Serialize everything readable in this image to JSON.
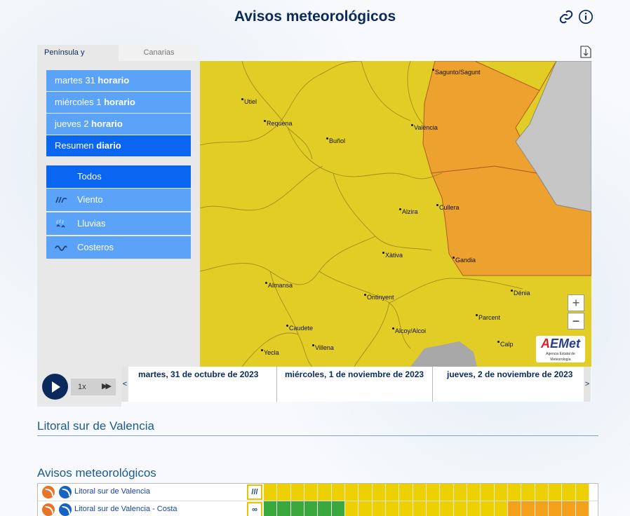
{
  "header": {
    "title": "Avisos meteorológicos"
  },
  "icons": {
    "link": "link-icon",
    "info": "info-icon",
    "download": "download-icon"
  },
  "tabs": [
    {
      "label": "Península y Baleares",
      "active": true
    },
    {
      "label": "Canarias",
      "active": false
    }
  ],
  "days": [
    {
      "prefix": "martes 31 ",
      "bold": "horario",
      "selected": false
    },
    {
      "prefix": "miércoles 1 ",
      "bold": "horario",
      "selected": false
    },
    {
      "prefix": "jueves 2 ",
      "bold": "horario",
      "selected": false
    },
    {
      "prefix": "Resumen ",
      "bold": "diario",
      "selected": true
    }
  ],
  "warning_types": [
    {
      "label": "Todos",
      "icon": "",
      "selected": true
    },
    {
      "label": "Viento",
      "icon": "wind-icon",
      "selected": false
    },
    {
      "label": "Lluvias",
      "icon": "rain-icon",
      "selected": false
    },
    {
      "label": "Costeros",
      "icon": "coastal-icon",
      "selected": false
    }
  ],
  "map": {
    "cities": [
      {
        "name": "Sagunto/Sagunt",
        "id": "sagunto"
      },
      {
        "name": "Utiel",
        "id": "utiel"
      },
      {
        "name": "Requena",
        "id": "requena"
      },
      {
        "name": "València",
        "id": "valencia"
      },
      {
        "name": "Buñol",
        "id": "bunol"
      },
      {
        "name": "Alzira",
        "id": "alzira"
      },
      {
        "name": "Cullera",
        "id": "cullera"
      },
      {
        "name": "Xàtiva",
        "id": "xativa"
      },
      {
        "name": "Gandia",
        "id": "gandia"
      },
      {
        "name": "Almansa",
        "id": "almansa"
      },
      {
        "name": "Dénia",
        "id": "denia"
      },
      {
        "name": "Ontinyent",
        "id": "ontinyent"
      },
      {
        "name": "Parcent",
        "id": "parcent"
      },
      {
        "name": "Caudete",
        "id": "caudete"
      },
      {
        "name": "Alcoy/Alcoi",
        "id": "alcoy"
      },
      {
        "name": "Calp",
        "id": "calp"
      },
      {
        "name": "Villena",
        "id": "villena"
      },
      {
        "name": "Yecla",
        "id": "yecla"
      }
    ],
    "zoom_in": "+",
    "zoom_out": "−",
    "logo_main": "AEMet",
    "logo_sub": "Agencia Estatal de Meteorología",
    "colors": {
      "yellow": "#e2cd26",
      "orange": "#eda22f",
      "grey": "#c6c6c6"
    }
  },
  "player": {
    "speed": "1x",
    "forward": "▶▶"
  },
  "timeline": {
    "left_arrow": "<",
    "right_arrow": ">",
    "days": [
      "martes, 31 de octubre de 2023",
      "miércoles, 1 de noviembre de 2023",
      "jueves, 2 de noviembre de 2023"
    ]
  },
  "zone_title": "Litoral sur de Valencia",
  "warnings_title": "Avisos meteorológicos",
  "warnings": [
    {
      "zone": "Litoral sur de Valencia",
      "icon": "wind-icon",
      "cells": [
        "y",
        "y",
        "y",
        "y",
        "y",
        "y",
        "y",
        "y",
        "y",
        "y",
        "y",
        "y",
        "y",
        "y",
        "y",
        "y",
        "y",
        "y",
        "y",
        "y",
        "y",
        "y",
        "y",
        "y"
      ]
    },
    {
      "zone": "Litoral sur de Valencia - Costa",
      "icon": "coastal-icon",
      "cells": [
        "g",
        "g",
        "g",
        "g",
        "g",
        "g",
        "y",
        "y",
        "y",
        "y",
        "y",
        "y",
        "y",
        "y",
        "y",
        "y",
        "y",
        "y",
        "o",
        "o",
        "o",
        "o",
        "o",
        "o"
      ]
    }
  ],
  "cell_colors": {
    "y": "#ecd000",
    "g": "#3aa83d",
    "o": "#f3a11b"
  }
}
